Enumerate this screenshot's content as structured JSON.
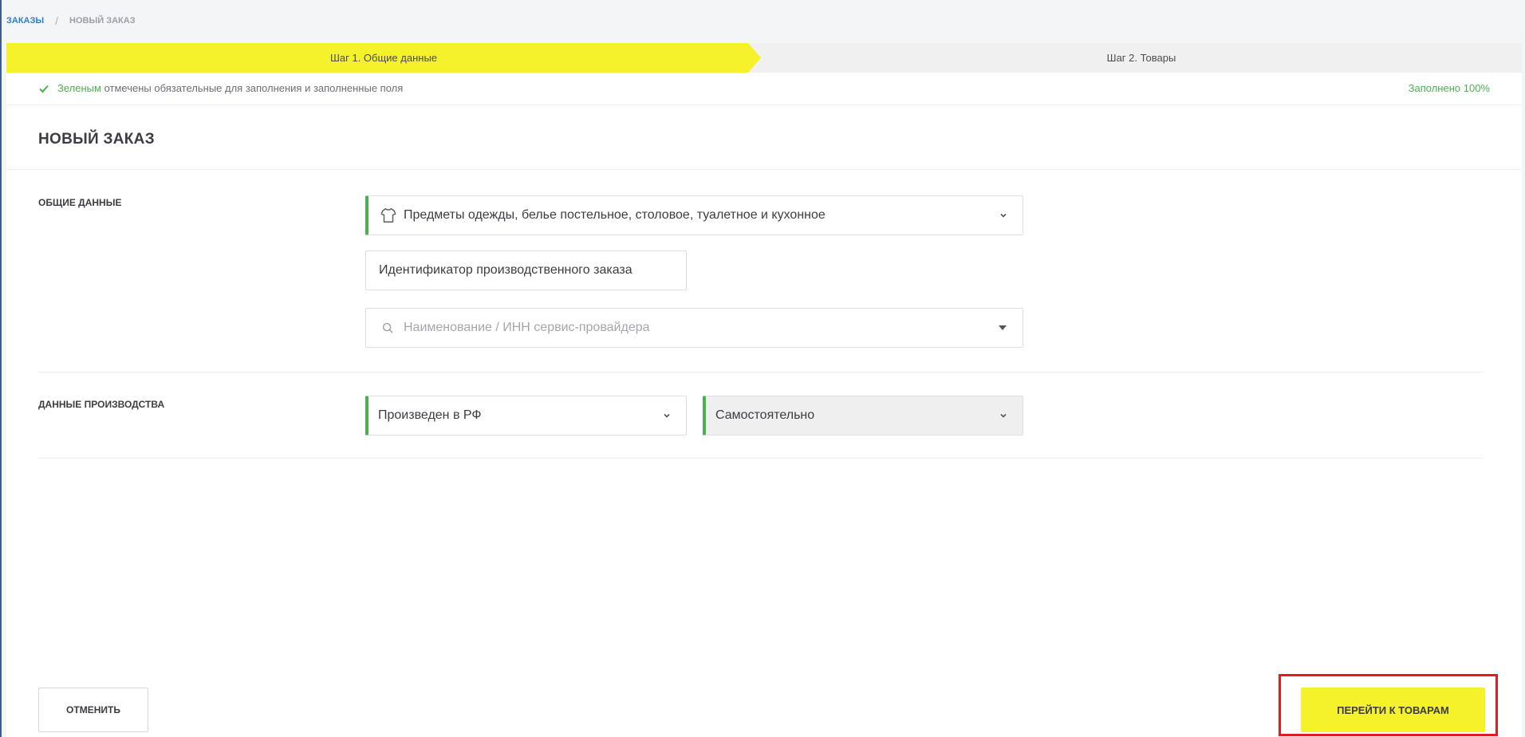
{
  "breadcrumb": {
    "parent": "ЗАКАЗЫ",
    "separator": "/",
    "current": "НОВЫЙ ЗАКАЗ"
  },
  "steps": [
    {
      "label": "Шаг 1. Общие данные",
      "active": true
    },
    {
      "label": "Шаг 2. Товары",
      "active": false
    }
  ],
  "hint": {
    "green_word": "Зеленым",
    "text": "отмечены обязательные для заполнения и заполненные поля",
    "progress": "Заполнено 100%"
  },
  "page_title": "НОВЫЙ ЗАКАЗ",
  "sections": {
    "general": {
      "label": "ОБЩИЕ ДАННЫЕ",
      "category": "Предметы одежды, белье постельное, столовое, туалетное и кухонное",
      "order_id_placeholder": "Идентификатор производственного заказа",
      "provider_placeholder": "Наименование / ИНН сервис-провайдера"
    },
    "production": {
      "label": "ДАННЫЕ ПРОИЗВОДСТВА",
      "origin": "Произведен в РФ",
      "mode": "Самостоятельно"
    }
  },
  "actions": {
    "cancel": "ОТМЕНИТЬ",
    "next": "ПЕРЕЙТИ К ТОВАРАМ"
  },
  "colors": {
    "accent_yellow": "#f5f12a",
    "valid_green": "#4cb04f",
    "link_blue": "#2f7ecb",
    "highlight_red": "#e11b22"
  },
  "icons": {
    "check": "check-icon",
    "shirt": "shirt-icon",
    "search": "search-icon",
    "chevron": "chevron-down-icon",
    "caret": "caret-down-icon"
  }
}
